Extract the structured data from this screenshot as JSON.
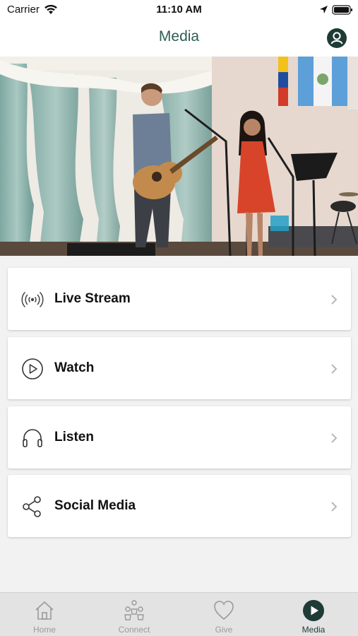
{
  "status_bar": {
    "carrier": "Carrier",
    "time": "11:10 AM"
  },
  "nav": {
    "title": "Media"
  },
  "menu": {
    "items": [
      {
        "label": "Live Stream",
        "icon": "broadcast-icon"
      },
      {
        "label": "Watch",
        "icon": "play-circle-icon"
      },
      {
        "label": "Listen",
        "icon": "headphones-icon"
      },
      {
        "label": "Social Media",
        "icon": "share-icon"
      }
    ]
  },
  "tab_bar": {
    "active": "Media",
    "tabs": [
      {
        "label": "Home",
        "icon": "home-icon"
      },
      {
        "label": "Connect",
        "icon": "people-icon"
      },
      {
        "label": "Give",
        "icon": "heart-icon"
      },
      {
        "label": "Media",
        "icon": "play-circle-filled-icon"
      }
    ]
  },
  "colors": {
    "accent": "#1e3b36",
    "title": "#2f5d54",
    "inactive": "#9a9a9a"
  }
}
